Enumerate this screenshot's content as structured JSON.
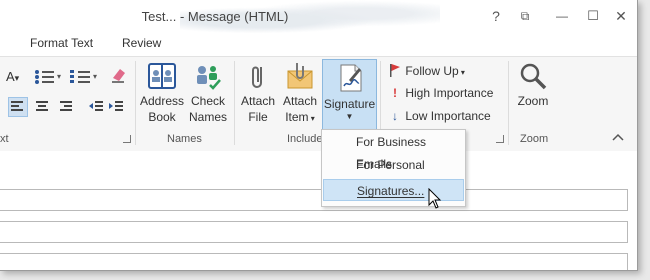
{
  "window": {
    "title": "Test... - Message (HTML)",
    "buttons": {
      "help": "?",
      "ribbon_display": "⧉",
      "minimize": "—",
      "maximize": "☐",
      "close": "✕"
    }
  },
  "tabs": [
    "Format Text",
    "Review"
  ],
  "ribbon": {
    "basic_text_partial_label": "xt",
    "names_group": {
      "label": "Names",
      "address_book": [
        "Address",
        "Book"
      ],
      "check_names": [
        "Check",
        "Names"
      ]
    },
    "include_group": {
      "label": "Include",
      "attach_file": [
        "Attach",
        "File"
      ],
      "attach_item": [
        "Attach",
        "Item"
      ],
      "signature": "Signature"
    },
    "tags_group": {
      "follow_up": "Follow Up",
      "high_importance": "High Importance",
      "low_importance": "Low Importance"
    },
    "zoom_group": {
      "label": "Zoom",
      "zoom": "Zoom"
    }
  },
  "signature_menu": {
    "items": [
      "For Business Emails",
      "For Personal Emails",
      "Signatures..."
    ]
  },
  "colors": {
    "accent": "#2b579a",
    "highlight": "#cfe4f6",
    "flag_red": "#d83b3b"
  }
}
